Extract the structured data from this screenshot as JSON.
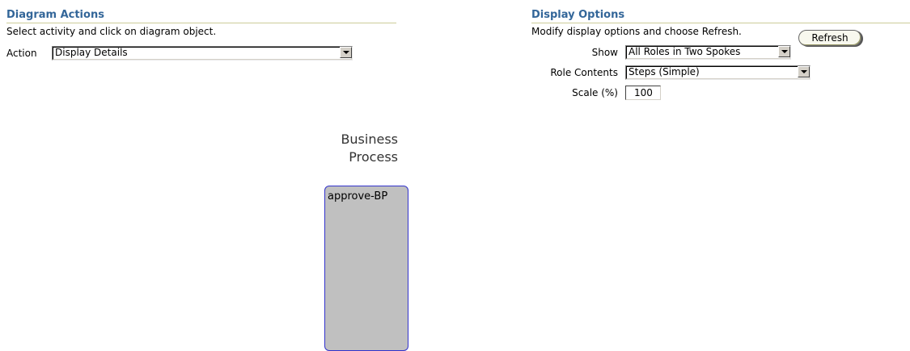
{
  "diagram_actions": {
    "title": "Diagram Actions",
    "instruction": "Select activity and click on diagram object.",
    "action_label": "Action",
    "action_value": "Display Details"
  },
  "display_options": {
    "title": "Display Options",
    "instruction": "Modify display options and choose Refresh.",
    "refresh_label": "Refresh",
    "show_label": "Show",
    "show_value": "All Roles in Two Spokes",
    "role_contents_label": "Role Contents",
    "role_contents_value": "Steps (Simple)",
    "scale_label": "Scale (%)",
    "scale_value": "100"
  },
  "diagram": {
    "title_line1": "Business",
    "title_line2": "Process",
    "process_name": "approve-BP",
    "box_fill": "#c0c0c0",
    "box_border": "#3333cc"
  },
  "colors": {
    "section_title": "#336699",
    "section_rule": "#cccc99"
  }
}
